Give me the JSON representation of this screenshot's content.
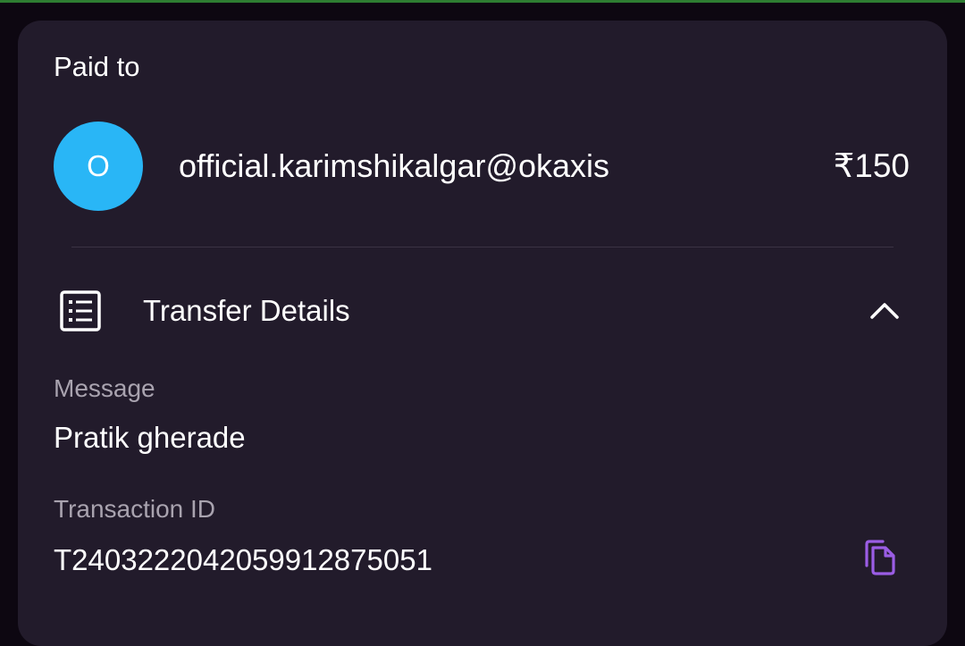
{
  "header": {
    "paid_to_label": "Paid to"
  },
  "payee": {
    "avatar_initial": "O",
    "avatar_color": "#29b6f6",
    "upi_id": "official.karimshikalgar@okaxis",
    "amount": "₹150"
  },
  "transfer_details": {
    "title": "Transfer Details",
    "icon": "receipt-list-icon",
    "expanded": true,
    "message_label": "Message",
    "message_value": "Pratik gherade",
    "transaction_id_label": "Transaction ID",
    "transaction_id_value": "T2403222042059912875051",
    "copy_icon": "copy-icon"
  },
  "colors": {
    "background": "#0d0711",
    "card": "#221b2b",
    "accent": "#9b5de5",
    "status_bar": "#2e7d32"
  }
}
